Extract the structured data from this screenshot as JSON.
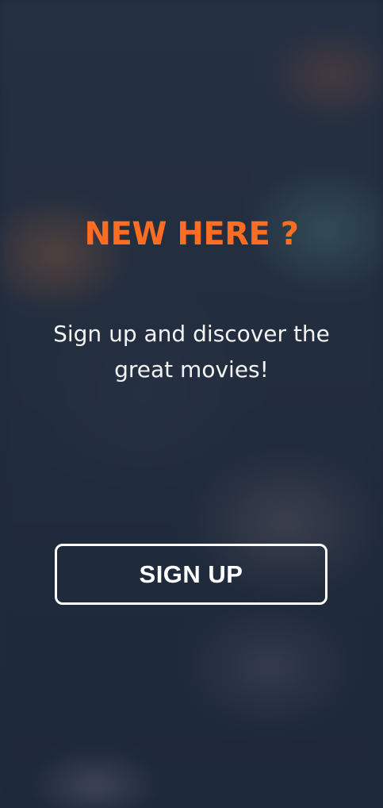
{
  "welcome": {
    "title": "NEW HERE ?",
    "subtitle": "Sign up and discover the great movies!",
    "signup_label": "SIGN UP"
  },
  "colors": {
    "accent": "#ff6d22",
    "text": "#ffffff",
    "background": "#1f2a3c"
  }
}
